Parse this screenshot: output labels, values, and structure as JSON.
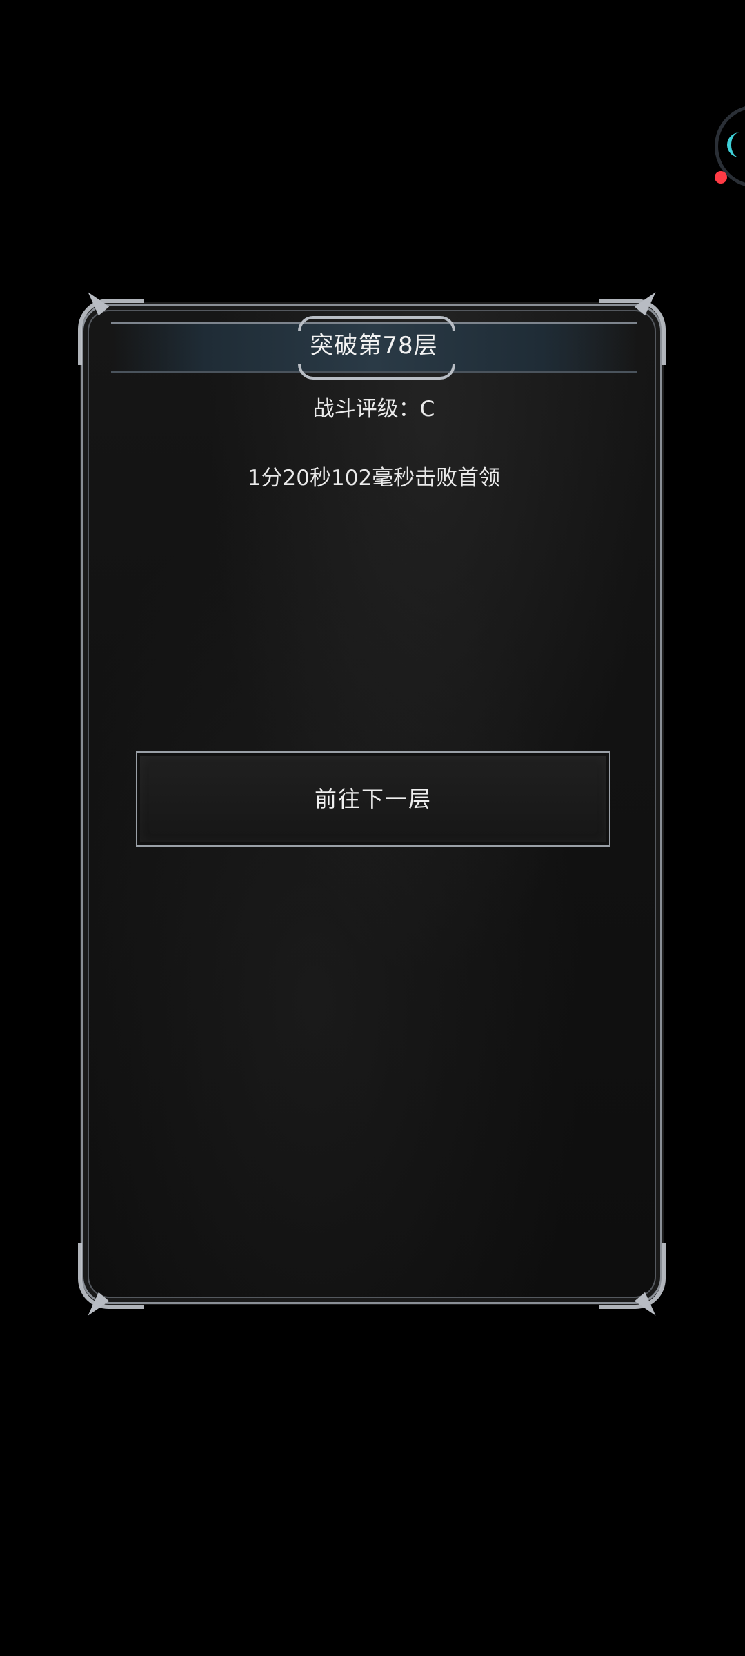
{
  "dialog": {
    "title": "突破第78层",
    "rating_text": "战斗评级：C",
    "time_text": "1分20秒102毫秒击败首领",
    "next_button_label": "前往下一层"
  },
  "overlay": {
    "widget_icon": "floating-assistant-icon",
    "accent_color": "#3fd0d8",
    "dot_color": "#ff3b45"
  }
}
